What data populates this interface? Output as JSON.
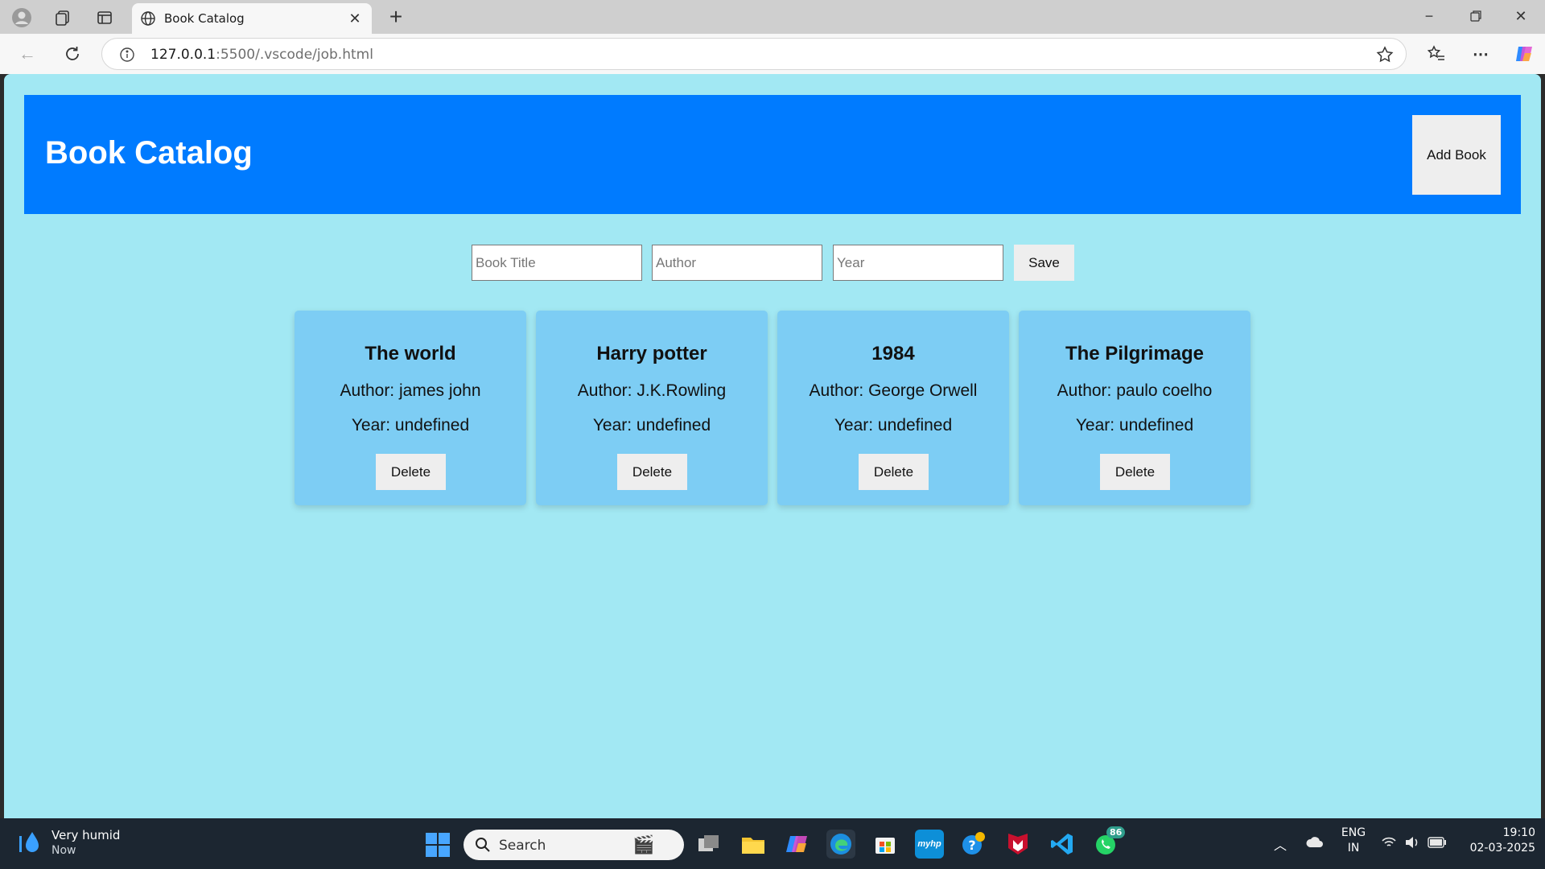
{
  "browser": {
    "tab_title": "Book Catalog",
    "url_host": "127.0.0.1",
    "url_path": ":5500/.vscode/job.html"
  },
  "page": {
    "title": "Book Catalog",
    "add_button": "Add Book",
    "form": {
      "title_placeholder": "Book Title",
      "author_placeholder": "Author",
      "year_placeholder": "Year",
      "save_label": "Save"
    },
    "books": [
      {
        "title": "The world",
        "author": "Author: james john",
        "year": "Year: undefined",
        "delete_label": "Delete"
      },
      {
        "title": "Harry potter",
        "author": "Author: J.K.Rowling",
        "year": "Year: undefined",
        "delete_label": "Delete"
      },
      {
        "title": "1984",
        "author": "Author: George Orwell",
        "year": "Year: undefined",
        "delete_label": "Delete"
      },
      {
        "title": "The Pilgrimage",
        "author": "Author: paulo coelho",
        "year": "Year: undefined",
        "delete_label": "Delete"
      }
    ]
  },
  "taskbar": {
    "weather_title": "Very humid",
    "weather_sub": "Now",
    "search_label": "Search",
    "whatsapp_badge": "86",
    "lang_line1": "ENG",
    "lang_line2": "IN",
    "time": "19:10",
    "date": "02-03-2025"
  },
  "colors": {
    "page_bg": "#a2e8f3",
    "header_bg": "#007bff",
    "card_bg": "#7dcdf4",
    "button_bg": "#eeeeee"
  }
}
